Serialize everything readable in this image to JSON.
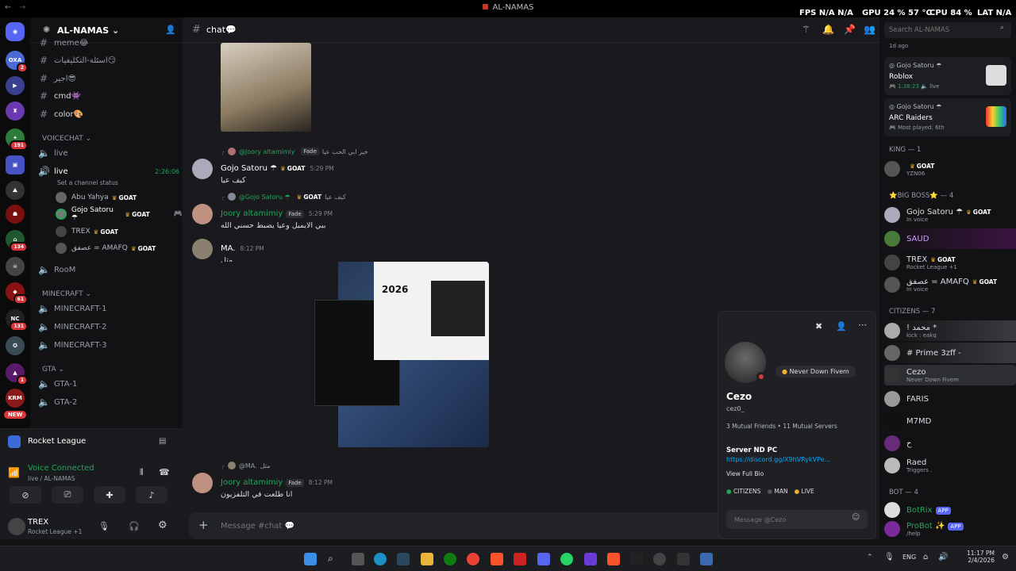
{
  "window": {
    "title": "AL-NAMAS",
    "overlay": {
      "fps_label": "FPS",
      "fps": "N/A",
      "fps2": "N/A",
      "gpu_label": "GPU",
      "gpu": "24 % 57 °C",
      "cpu_label": "CPU",
      "cpu": "84 %",
      "lat_label": "LAT",
      "lat": "N/A"
    }
  },
  "rail": {
    "badges": [
      "2",
      "191",
      "134",
      "61",
      "131",
      "1"
    ],
    "new_label": "NEW"
  },
  "server": {
    "name": "AL-NAMAS",
    "channels": [
      {
        "name": "meme",
        "emoji": "😂"
      },
      {
        "name": "اسئلة-التكليفيات",
        "emoji": "😏"
      },
      {
        "name": "اجير",
        "emoji": "😎"
      },
      {
        "name": "cmd",
        "emoji": "👾"
      },
      {
        "name": "color",
        "emoji": "🎨"
      }
    ],
    "voicechat_label": "VOICECHAT",
    "voice_live1": "live",
    "voice_live2": "live",
    "live_time": "2:26:06",
    "channel_status": "Set a channel status",
    "voice_users": [
      {
        "name": "Abu Yahya",
        "tag": "GOAT"
      },
      {
        "name": "Gojo Satoru ☂",
        "tag": "GOAT"
      },
      {
        "name": "TREX",
        "tag": "GOAT"
      },
      {
        "name": "عصفق = AMAFQ",
        "tag": "GOAT"
      }
    ],
    "room": "RooM",
    "minecraft_label": "MINECRAFT",
    "minecraft": [
      "MINECRAFT-1",
      "MINECRAFT-2",
      "MINECRAFT-3"
    ],
    "gta_label": "GTA",
    "gta": [
      "GTA-1",
      "GTA-2"
    ]
  },
  "user_panel": {
    "activity": "Rocket League",
    "voice_status": "Voice Connected",
    "voice_channel": "live / AL-NAMAS",
    "username": "TREX",
    "user_status": "Rocket League +1"
  },
  "channel": {
    "name": "chat",
    "emoji": "💬",
    "composer_placeholder": "Message #chat 💬"
  },
  "messages": [
    {
      "reply_to": "@Joory altamimiy",
      "reply_tag": "Fade",
      "reply_text": "خير ابي الحب عيا",
      "author": "Gojo Satoru ☂",
      "tag": "GOAT",
      "time": "5:29 PM",
      "text": "كيف عيا"
    },
    {
      "reply_to": "@Gojo Satoru ☂",
      "reply_tag": "GOAT",
      "reply_text": "كيف عيا",
      "author": "Joory altamimiy",
      "tag": "Fade",
      "time": "5:29 PM",
      "text": "ببي الايميل وعيا يضبط حسني الله"
    },
    {
      "author": "MA.",
      "time": "8:12 PM",
      "text": "مثل"
    },
    {
      "reply_to": "@MA.",
      "reply_text": "مثل",
      "author": "Joory altamimiy",
      "tag": "Fade",
      "time": "8:12 PM",
      "text": "انا طلعت في التلفزيون"
    }
  ],
  "attachment_year": "2026",
  "members": {
    "activities": [
      {
        "title": "1d ago"
      },
      {
        "user": "Gojo Satoru ☂",
        "game": "Roblox",
        "detail": "1:38:23",
        "status": "live"
      },
      {
        "user": "Gojo Satoru ☂",
        "game": "ARC Raiders",
        "detail": "Most played: 6th"
      }
    ],
    "groups": [
      {
        "label": "KING — 1",
        "members": [
          {
            "name": "",
            "status": "YZN06",
            "tag": "GOAT"
          }
        ]
      },
      {
        "label": "⭐BIG BOSS⭐ — 4",
        "members": [
          {
            "name": "Gojo Satoru ☂",
            "status": "In voice",
            "tag": "GOAT"
          },
          {
            "name": "SAUD",
            "status": ""
          },
          {
            "name": "TREX",
            "status": "Rocket League +1",
            "tag": "GOAT"
          },
          {
            "name": "عصفق = AMAFQ",
            "status": "In voice",
            "tag": "GOAT"
          }
        ]
      },
      {
        "label": "CITIZENS — 7",
        "members": [
          {
            "name": "! محمد *",
            "status": "kick : eakq"
          },
          {
            "name": "# Prime 3zff -",
            "status": ""
          },
          {
            "name": "Cezo",
            "status": "Never Down Fivem"
          },
          {
            "name": "FARIS",
            "status": ""
          },
          {
            "name": "M7MD",
            "status": ""
          },
          {
            "name": "ح",
            "status": ""
          },
          {
            "name": "Raed",
            "status": "Triggers ."
          }
        ]
      },
      {
        "label": "BOT — 4",
        "members": [
          {
            "name": "BotRix",
            "status": "",
            "tag": "APP"
          },
          {
            "name": "ProBot ✨",
            "status": "/help",
            "tag": "APP"
          }
        ]
      }
    ]
  },
  "search_placeholder": "Search AL-NAMAS",
  "profile": {
    "name": "Cezo",
    "username": "cez0_",
    "status": "Never Down Fivem",
    "mutual": "3 Mutual Friends",
    "mutual_servers": "11 Mutual Servers",
    "bio_title": "Server ND PC",
    "bio_link": "https://discord.gg/X9hVRykVPe...",
    "view_bio": "View Full Bio",
    "roles": [
      "CITIZENS",
      "MAN",
      "LIVE"
    ],
    "message_placeholder": "Message @Cezo"
  },
  "taskbar": {
    "lang": "ENG",
    "time": "11:17 PM",
    "date": "2/4/2026"
  },
  "colors": {
    "accent": "#5865f2",
    "online": "#23a55a",
    "dnd": "#da373c",
    "idle": "#f0b232"
  }
}
